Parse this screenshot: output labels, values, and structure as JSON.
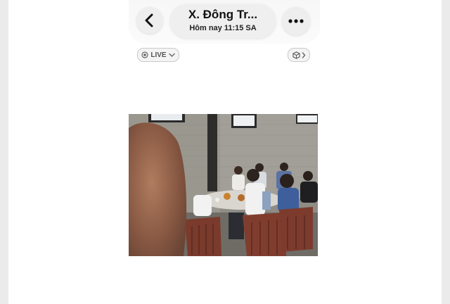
{
  "header": {
    "title": "X. Đông Tr...",
    "subtitle": "Hôm nay  11:15 SA"
  },
  "badges": {
    "live_label": "LIVE"
  },
  "icons": {
    "back": "chevron-left-icon",
    "more": "more-horizontal-icon",
    "live": "live-target-icon",
    "cube": "cube-icon"
  },
  "photo": {
    "subject": "group photo at a restaurant table"
  }
}
